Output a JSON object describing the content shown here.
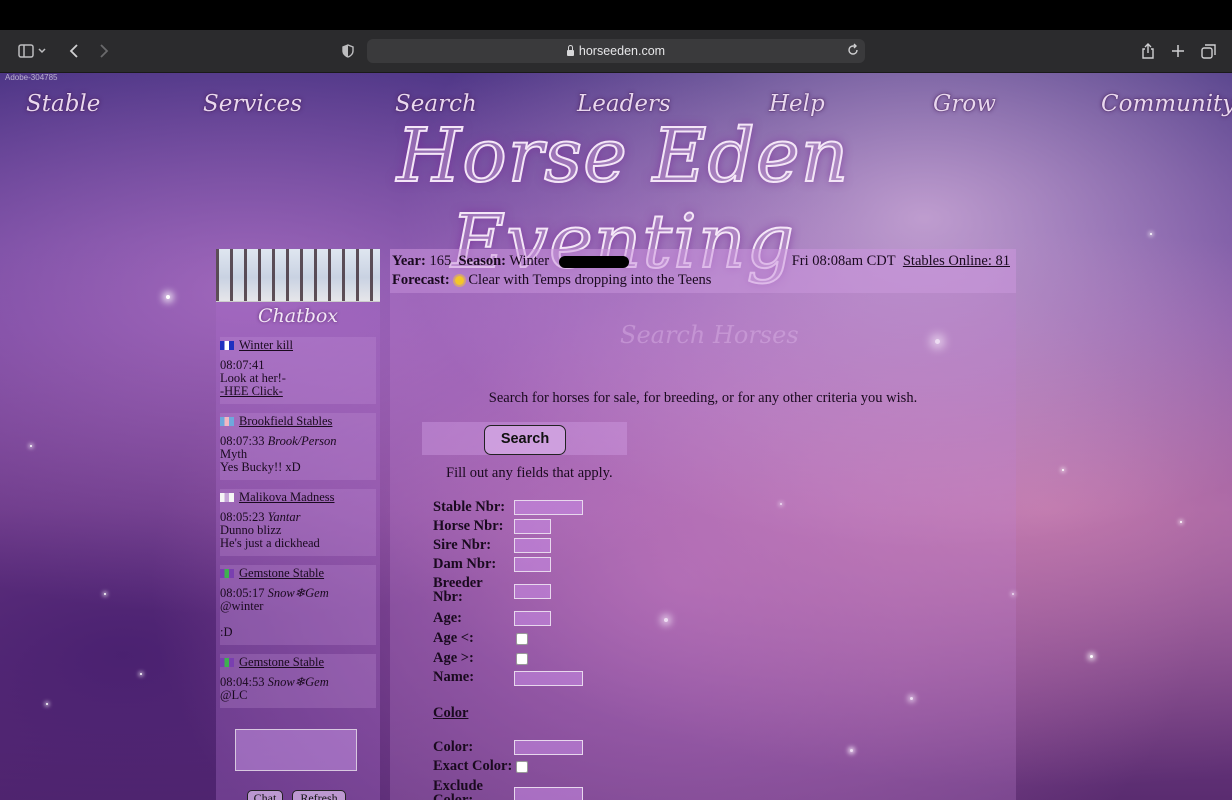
{
  "browser": {
    "url": "horseeden.com"
  },
  "page": {
    "watermark": "Adobe-304785",
    "nav": [
      "Stable",
      "Services",
      "Search",
      "Leaders",
      "Help",
      "Grow",
      "Community"
    ],
    "logo": "Horse Eden Eventing"
  },
  "chatbox": {
    "title": "Chatbox",
    "messages": [
      {
        "name": "Winter kill",
        "time": "08:07:41",
        "author": "",
        "lines": [
          "Look at her!-",
          "-HEE Click-"
        ],
        "flag_colors": [
          "#2030c0",
          "#ffffff",
          "#2030c0"
        ]
      },
      {
        "name": "Brookfield Stables",
        "time": "08:07:33",
        "author": "Brook/Person",
        "lines": [
          "Myth",
          "Yes Bucky!! xD"
        ],
        "flag_colors": [
          "#6fa8dc",
          "#f4b6c2",
          "#6fa8dc"
        ]
      },
      {
        "name": "Malikova Madness",
        "time": "08:05:23",
        "author": "Yantar",
        "lines": [
          "Dunno blizz",
          "He's just a dickhead"
        ],
        "flag_colors": [
          "#f5f5f5",
          "#c7a6d9",
          "#f5f5f5"
        ]
      },
      {
        "name": "Gemstone Stable",
        "time": "08:05:17",
        "author": "Snow❄Gem",
        "lines": [
          "@winter",
          "",
          ":D"
        ],
        "flag_colors": [
          "#7a3fb0",
          "#3fb050",
          "#7a3fb0"
        ]
      },
      {
        "name": "Gemstone Stable",
        "time": "08:04:53",
        "author": "Snow❄Gem",
        "lines": [
          "@LC"
        ],
        "flag_colors": [
          "#7a3fb0",
          "#3fb050",
          "#7a3fb0"
        ]
      }
    ],
    "chat_button": "Chat",
    "refresh_button": "Refresh"
  },
  "status": {
    "year_label": "Year:",
    "year": "165",
    "season_label": "Season:",
    "season": "Winter",
    "forecast_label": "Forecast:",
    "forecast": "Clear with Temps dropping into the Teens",
    "datetime": "Fri 08:08am CDT",
    "stables_online": "Stables Online: 81"
  },
  "search": {
    "heading": "Search Horses",
    "intro": "Search for horses for sale, for breeding, or for any other criteria you wish.",
    "button": "Search",
    "fill_note": "Fill out any fields that apply.",
    "fields": {
      "stable_nbr": "Stable Nbr:",
      "horse_nbr": "Horse Nbr:",
      "sire_nbr": "Sire Nbr:",
      "dam_nbr": "Dam Nbr:",
      "breeder_nbr": "Breeder Nbr:",
      "age": "Age:",
      "age_lt": "Age <:",
      "age_gt": "Age >:",
      "name": "Name:"
    },
    "color_section": "Color",
    "color_fields": {
      "color": "Color:",
      "exact_color": "Exact Color:",
      "exclude_color": "Exclude Color:"
    }
  }
}
